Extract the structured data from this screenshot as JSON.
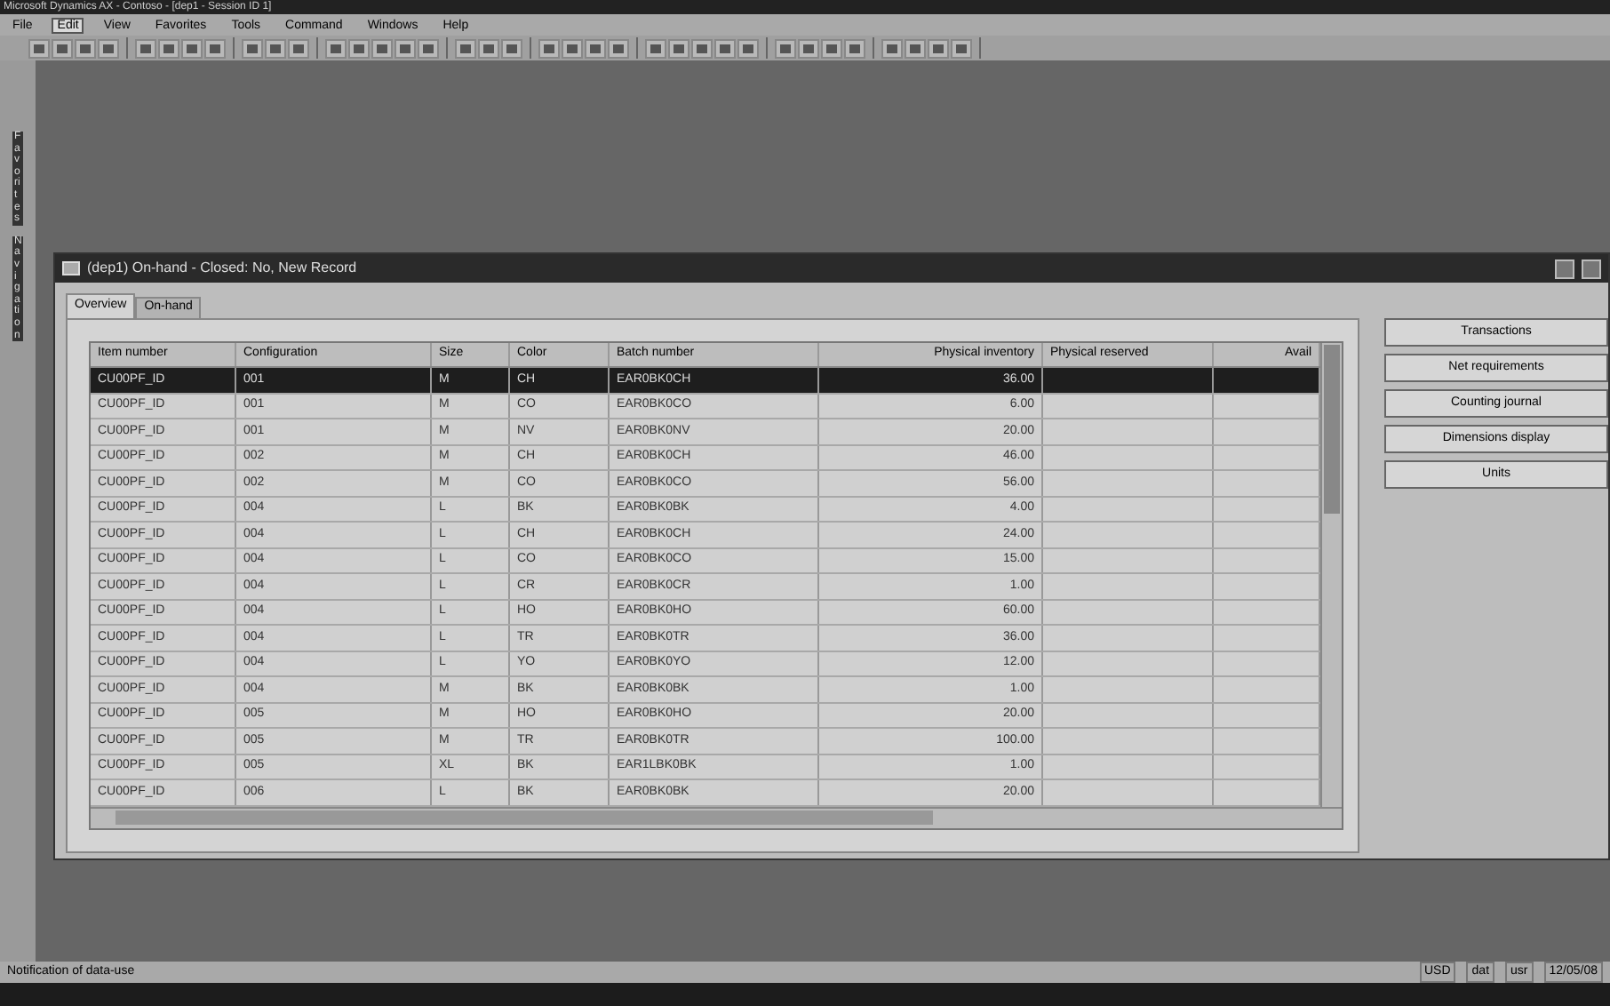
{
  "app_title": "Microsoft Dynamics AX - Contoso - [dep1 - Session ID 1]",
  "menu": [
    {
      "label": "File",
      "selected": false
    },
    {
      "label": "Edit",
      "selected": true
    },
    {
      "label": "View",
      "selected": false
    },
    {
      "label": "Favorites",
      "selected": false
    },
    {
      "label": "Tools",
      "selected": false
    },
    {
      "label": "Command",
      "selected": false
    },
    {
      "label": "Windows",
      "selected": false
    },
    {
      "label": "Help",
      "selected": false
    }
  ],
  "left_strip": [
    "Favorites",
    "Navigation"
  ],
  "form": {
    "title": "(dep1) On-hand - Closed: No, New Record",
    "tabs": [
      {
        "label": "Overview",
        "selected": true
      },
      {
        "label": "On-hand",
        "selected": false
      }
    ],
    "columns": [
      "Item number",
      "Configuration",
      "Size",
      "Color",
      "Batch number",
      "Physical inventory",
      "Physical reserved",
      "Avail"
    ],
    "rows": [
      {
        "cells": [
          "CU00PF_ID",
          "001",
          "M",
          "CH",
          "EAR0BK0CH",
          "36.00"
        ],
        "selected": true
      },
      {
        "cells": [
          "CU00PF_ID",
          "001",
          "M",
          "CO",
          "EAR0BK0CO",
          "6.00"
        ],
        "selected": false
      },
      {
        "cells": [
          "CU00PF_ID",
          "001",
          "M",
          "NV",
          "EAR0BK0NV",
          "20.00"
        ],
        "selected": false
      },
      {
        "cells": [
          "CU00PF_ID",
          "002",
          "M",
          "CH",
          "EAR0BK0CH",
          "46.00"
        ],
        "selected": false
      },
      {
        "cells": [
          "CU00PF_ID",
          "002",
          "M",
          "CO",
          "EAR0BK0CO",
          "56.00"
        ],
        "selected": false
      },
      {
        "cells": [
          "CU00PF_ID",
          "004",
          "L",
          "BK",
          "EAR0BK0BK",
          "4.00"
        ],
        "selected": false
      },
      {
        "cells": [
          "CU00PF_ID",
          "004",
          "L",
          "CH",
          "EAR0BK0CH",
          "24.00"
        ],
        "selected": false
      },
      {
        "cells": [
          "CU00PF_ID",
          "004",
          "L",
          "CO",
          "EAR0BK0CO",
          "15.00"
        ],
        "selected": false
      },
      {
        "cells": [
          "CU00PF_ID",
          "004",
          "L",
          "CR",
          "EAR0BK0CR",
          "1.00"
        ],
        "selected": false
      },
      {
        "cells": [
          "CU00PF_ID",
          "004",
          "L",
          "HO",
          "EAR0BK0HO",
          "60.00"
        ],
        "selected": false
      },
      {
        "cells": [
          "CU00PF_ID",
          "004",
          "L",
          "TR",
          "EAR0BK0TR",
          "36.00"
        ],
        "selected": false
      },
      {
        "cells": [
          "CU00PF_ID",
          "004",
          "L",
          "YO",
          "EAR0BK0YO",
          "12.00"
        ],
        "selected": false
      },
      {
        "cells": [
          "CU00PF_ID",
          "004",
          "M",
          "BK",
          "EAR0BK0BK",
          "1.00"
        ],
        "selected": false
      },
      {
        "cells": [
          "CU00PF_ID",
          "005",
          "M",
          "HO",
          "EAR0BK0HO",
          "20.00"
        ],
        "selected": false
      },
      {
        "cells": [
          "CU00PF_ID",
          "005",
          "M",
          "TR",
          "EAR0BK0TR",
          "100.00"
        ],
        "selected": false
      },
      {
        "cells": [
          "CU00PF_ID",
          "005",
          "XL",
          "BK",
          "EAR1LBK0BK",
          "1.00"
        ],
        "selected": false
      },
      {
        "cells": [
          "CU00PF_ID",
          "006",
          "L",
          "BK",
          "EAR0BK0BK",
          "20.00"
        ],
        "selected": false
      }
    ],
    "buttons": [
      "Transactions",
      "Net requirements",
      "Counting journal",
      "Dimensions display",
      "Units"
    ]
  },
  "status_bar": {
    "message": "Notification of data-use",
    "items": [
      "USD",
      "dat",
      "usr",
      "12/05/08"
    ]
  }
}
